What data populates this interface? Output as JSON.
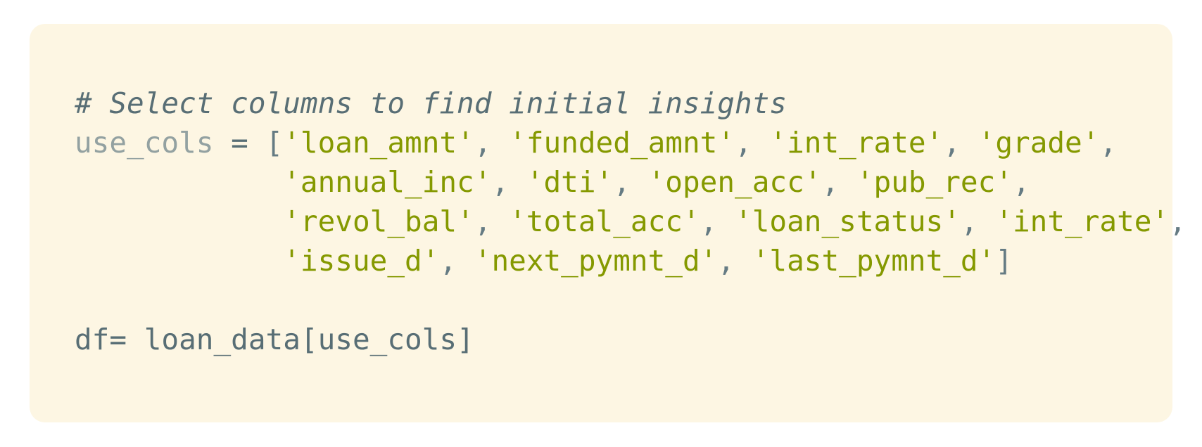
{
  "code": {
    "comment": "# Select columns to find initial insights",
    "var_name": "use_cols",
    "assign_op": " = ",
    "open_bracket": "[",
    "close_bracket": "]",
    "separator": ", ",
    "indent": "            ",
    "strings": [
      "'loan_amnt'",
      "'funded_amnt'",
      "'int_rate'",
      "'grade'",
      "'annual_inc'",
      "'dti'",
      "'open_acc'",
      "'pub_rec'",
      "'revol_bal'",
      "'total_acc'",
      "'loan_status'",
      "'int_rate'",
      "'issue_d'",
      "'next_pymnt_d'",
      "'last_pymnt_d'"
    ],
    "last_line": "df= loan_data[use_cols]"
  },
  "colors": {
    "background": "#fdf6e3",
    "comment": "#586e75",
    "string": "#859900",
    "variable": "#93a1a1",
    "text": "#586e75"
  }
}
